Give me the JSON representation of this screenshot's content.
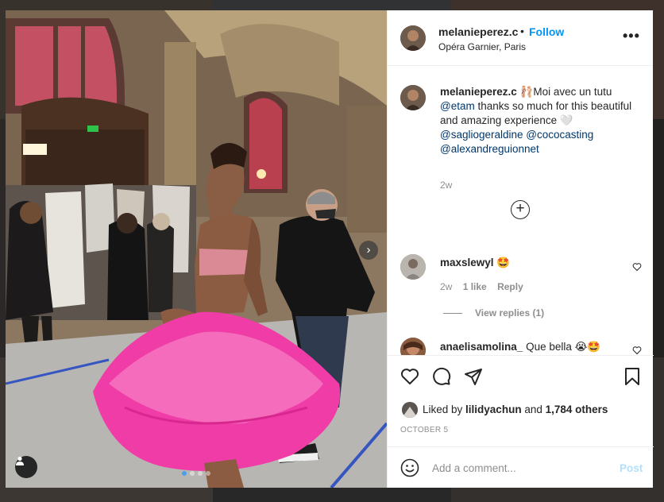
{
  "post": {
    "username": "melanieperez.c",
    "separator": "•",
    "follow_label": "Follow",
    "location": "Opéra Garnier, Paris",
    "more_label": "•••"
  },
  "caption": {
    "username": "melanieperez.c",
    "text_1": " 🩰Moi avec un tutu ",
    "mention_1": "@etam",
    "text_2": " thanks so much for this beautiful and amazing experience 🤍 ",
    "mention_2": "@saglіogeraldine",
    "mention_3": "@cococasting",
    "mention_4": "@alexandreguionnet",
    "time": "2w"
  },
  "comments": [
    {
      "username": "maxslewyl",
      "text": " 🤩",
      "time": "2w",
      "likes": "1 like",
      "reply_label": "Reply",
      "view_replies": "View replies (1)"
    },
    {
      "username": "anaelisamolina_",
      "text": " Que bella 😭🤩"
    }
  ],
  "actions": {
    "liked_by_prefix": "Liked by ",
    "liked_by_user": "lilidyachun",
    "liked_by_mid": " and ",
    "liked_by_others": "1,784 others",
    "date": "OCTOBER 5"
  },
  "composer": {
    "placeholder": "Add a comment...",
    "post_label": "Post"
  },
  "icons": {
    "more": "more-options-icon",
    "load_more": "plus-circle-icon",
    "heart": "heart-icon",
    "comment": "comment-icon",
    "share": "share-icon",
    "save": "bookmark-icon",
    "emoji": "emoji-icon",
    "tag": "user-tag-icon",
    "next": "chevron-right-icon"
  },
  "colors": {
    "accent": "#0095f6",
    "post_disabled": "#b2dffc",
    "tutu": "#f03ca6"
  },
  "carousel": {
    "slide_count": 4,
    "active_index": 0
  }
}
